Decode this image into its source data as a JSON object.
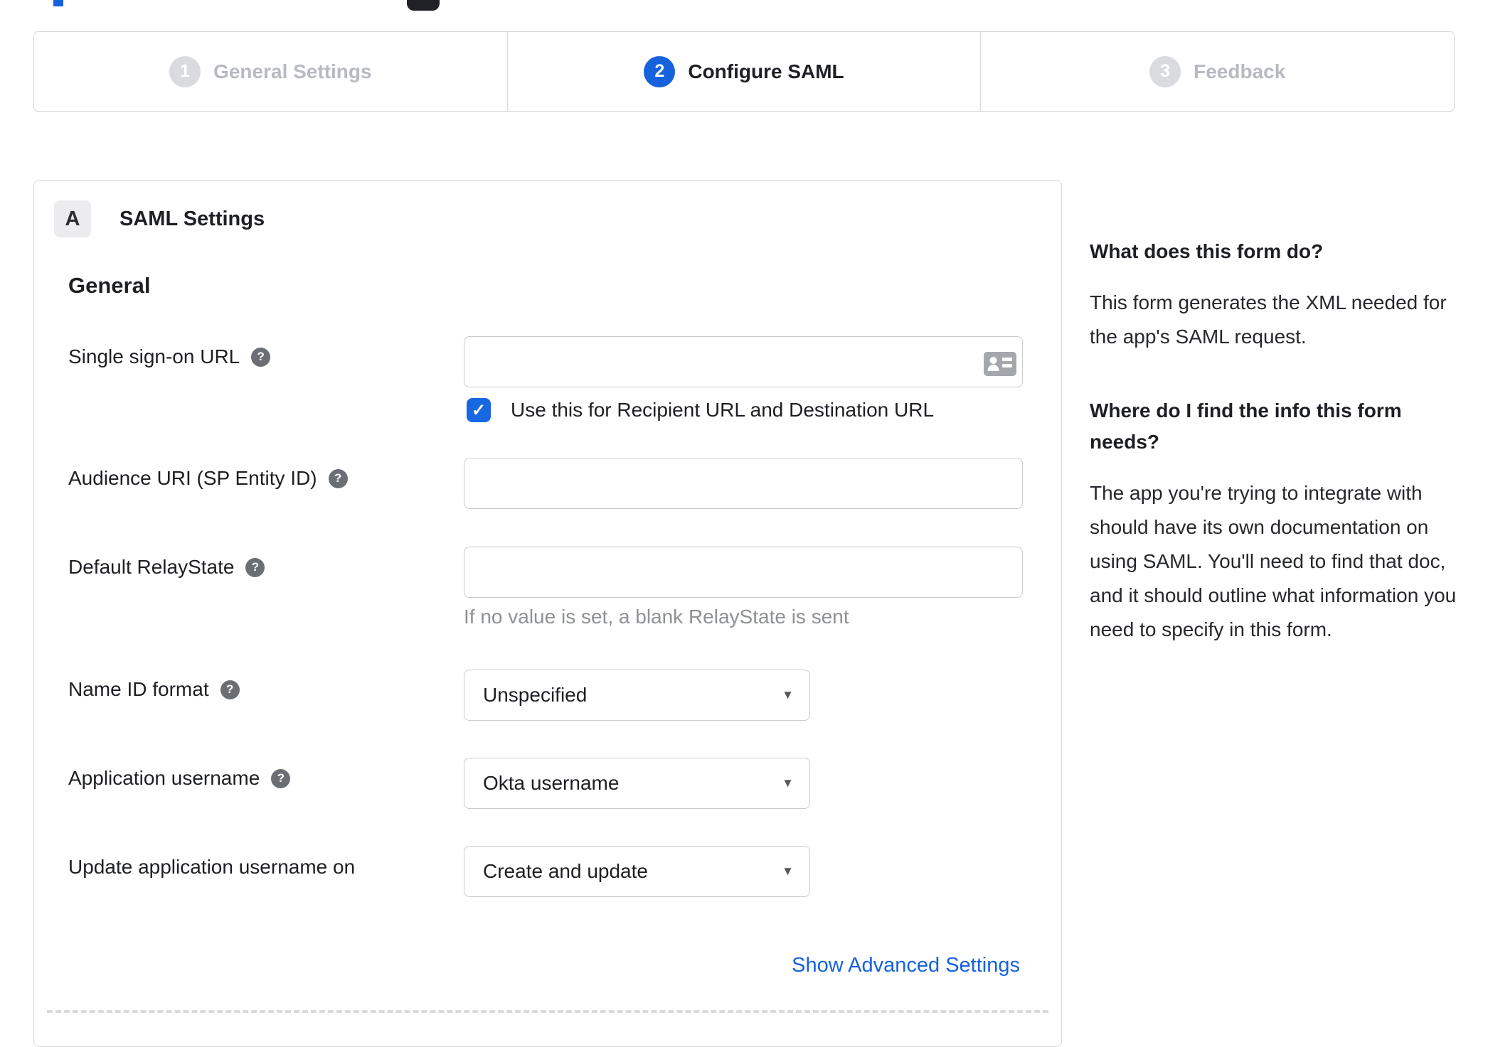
{
  "colors": {
    "accent_blue": "#1662dd",
    "border_gray": "#d5d7da",
    "inactive_gray": "#b7bac0"
  },
  "icons": {
    "help_glyph": "?",
    "check_glyph": "✓",
    "caret_glyph": "▼",
    "sso_input_icon": "contact-card-icon",
    "top_left_fragment": "blue-accent-cutoff",
    "top_center_fragment": "app-logo-cutoff"
  },
  "stepper": {
    "steps": [
      {
        "number": "1",
        "label": "General Settings",
        "active": false
      },
      {
        "number": "2",
        "label": "Configure SAML",
        "active": true
      },
      {
        "number": "3",
        "label": "Feedback",
        "active": false
      }
    ]
  },
  "panel": {
    "badge": "A",
    "title": "SAML Settings",
    "section": "General",
    "fields": {
      "sso_url": {
        "label": "Single sign-on URL",
        "value": "",
        "checkbox_label": "Use this for Recipient URL and Destination URL",
        "checkbox_checked": true
      },
      "audience_uri": {
        "label": "Audience URI (SP Entity ID)",
        "value": ""
      },
      "relay_state": {
        "label": "Default RelayState",
        "value": "",
        "hint": "If no value is set, a blank RelayState is sent"
      },
      "name_id_format": {
        "label": "Name ID format",
        "value": "Unspecified"
      },
      "app_username": {
        "label": "Application username",
        "value": "Okta username"
      },
      "update_username": {
        "label": "Update application username on",
        "value": "Create and update"
      }
    },
    "advanced_link": "Show Advanced Settings"
  },
  "sidebar": {
    "sections": [
      {
        "title": "What does this form do?",
        "body": "This form generates the XML needed for the app's SAML request."
      },
      {
        "title": "Where do I find the info this form needs?",
        "body": "The app you're trying to integrate with should have its own documentation on using SAML. You'll need to find that doc, and it should outline what information you need to specify in this form."
      }
    ]
  }
}
